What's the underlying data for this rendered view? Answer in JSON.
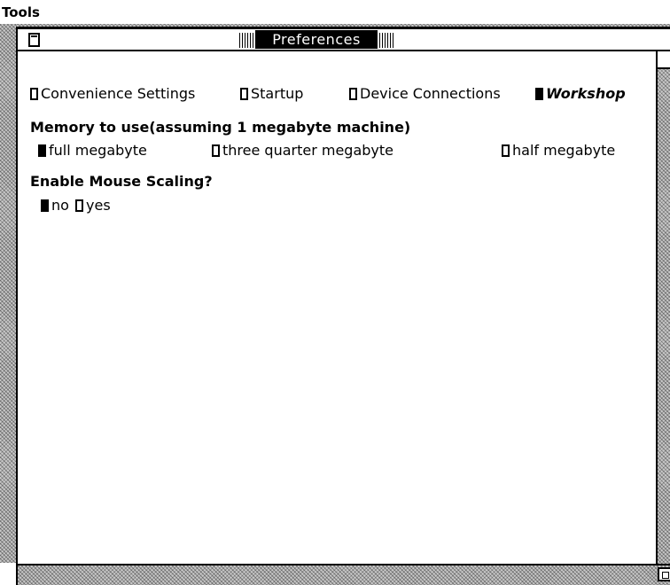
{
  "menu_bar": {
    "items": [
      "Tools"
    ]
  },
  "window": {
    "title": "Preferences"
  },
  "tabs": [
    {
      "label": "Convenience Settings",
      "selected": false
    },
    {
      "label": "Startup",
      "selected": false
    },
    {
      "label": "Device Connections",
      "selected": false
    },
    {
      "label": "Workshop",
      "selected": true
    }
  ],
  "memory": {
    "heading": "Memory to use(assuming 1 megabyte machine)",
    "options": [
      {
        "label": "full megabyte",
        "selected": true
      },
      {
        "label": "three quarter megabyte",
        "selected": false
      },
      {
        "label": "half megabyte",
        "selected": false
      }
    ]
  },
  "mouse_scaling": {
    "heading": "Enable Mouse Scaling?",
    "options": [
      {
        "label": "no",
        "selected": true
      },
      {
        "label": "yes",
        "selected": false
      }
    ]
  }
}
